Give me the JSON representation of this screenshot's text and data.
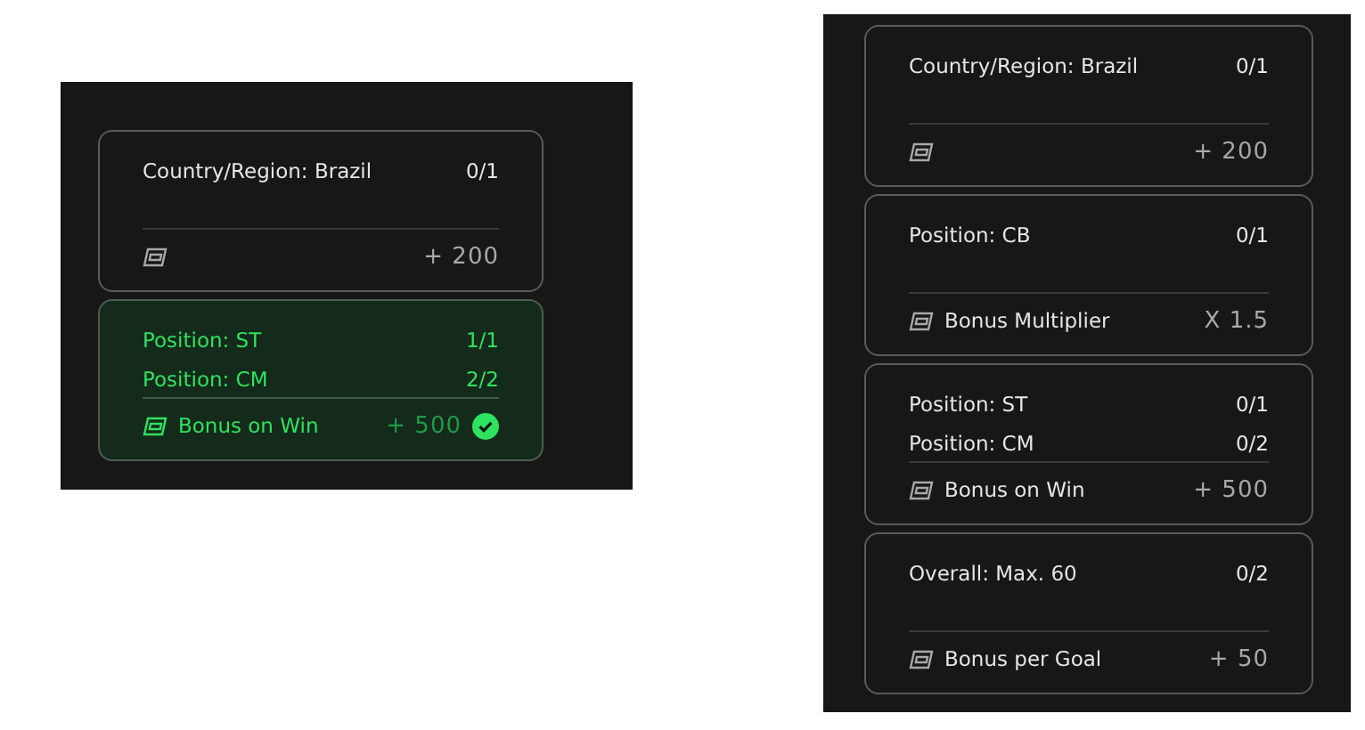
{
  "panels": [
    {
      "cards": [
        {
          "completed": false,
          "conditions": [
            {
              "label": "Country/Region: Brazil",
              "progress": "0/1"
            }
          ],
          "reward": {
            "value": "+ 200"
          }
        },
        {
          "completed": true,
          "conditions": [
            {
              "label": "Position: ST",
              "progress": "1/1"
            },
            {
              "label": "Position: CM",
              "progress": "2/2"
            }
          ],
          "reward": {
            "label": "Bonus on Win",
            "value": "+ 500"
          }
        }
      ]
    },
    {
      "cards": [
        {
          "completed": false,
          "conditions": [
            {
              "label": "Country/Region: Brazil",
              "progress": "0/1"
            }
          ],
          "reward": {
            "value": "+ 200"
          }
        },
        {
          "completed": false,
          "conditions": [
            {
              "label": "Position: CB",
              "progress": "0/1"
            }
          ],
          "reward": {
            "label": "Bonus Multiplier",
            "value": "X 1.5"
          }
        },
        {
          "completed": false,
          "conditions": [
            {
              "label": "Position: ST",
              "progress": "0/1"
            },
            {
              "label": "Position: CM",
              "progress": "0/2"
            }
          ],
          "reward": {
            "label": "Bonus on Win",
            "value": "+ 500"
          }
        },
        {
          "completed": false,
          "conditions": [
            {
              "label": "Overall: Max. 60",
              "progress": "0/2"
            }
          ],
          "reward": {
            "label": "Bonus per Goal",
            "value": "+ 50"
          }
        }
      ]
    }
  ]
}
